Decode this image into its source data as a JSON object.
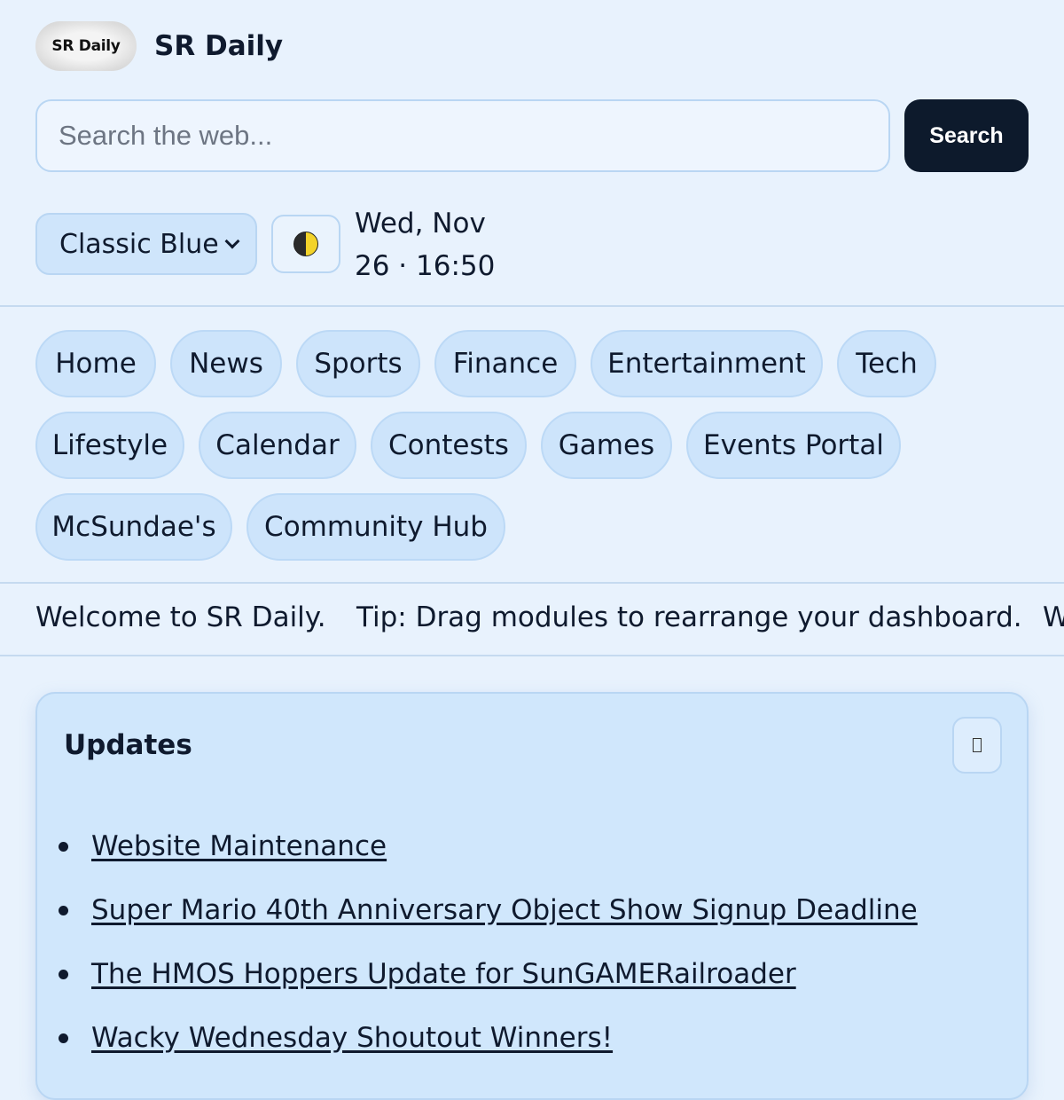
{
  "header": {
    "logo_text": "SR Daily",
    "title": "SR Daily",
    "search": {
      "placeholder": "Search the web...",
      "value": "",
      "button_label": "Search"
    },
    "theme_select": {
      "selected": "Classic Blue"
    },
    "theme_toggle_icon": "half-moon-icon",
    "date_line1": "Wed, Nov",
    "date_line2": "26 · 16:50"
  },
  "nav": {
    "items": [
      {
        "label": "Home"
      },
      {
        "label": "News"
      },
      {
        "label": "Sports"
      },
      {
        "label": "Finance"
      },
      {
        "label": "Entertainment"
      },
      {
        "label": "Tech"
      },
      {
        "label": "Lifestyle"
      },
      {
        "label": "Calendar"
      },
      {
        "label": "Contests"
      },
      {
        "label": "Games"
      },
      {
        "label": "Events Portal"
      },
      {
        "label": "McSundae's"
      },
      {
        "label": "Community Hub"
      }
    ]
  },
  "ticker": {
    "messages": [
      "Welcome to SR Daily.",
      "Tip: Drag modules to rearrange your dashboard.",
      "W"
    ]
  },
  "updates": {
    "title": "Updates",
    "items": [
      {
        "label": "Website Maintenance"
      },
      {
        "label": "Super Mario 40th Anniversary Object Show Signup Deadline"
      },
      {
        "label": "The HMOS Hoppers Update for SunGAMERailroader"
      },
      {
        "label": "Wacky Wednesday Shoutout Winners!"
      }
    ]
  },
  "colors": {
    "background": "#e8f2fd",
    "pill": "#cde4fb",
    "search_button": "#0d1a2c",
    "card": "#d0e7fc"
  }
}
